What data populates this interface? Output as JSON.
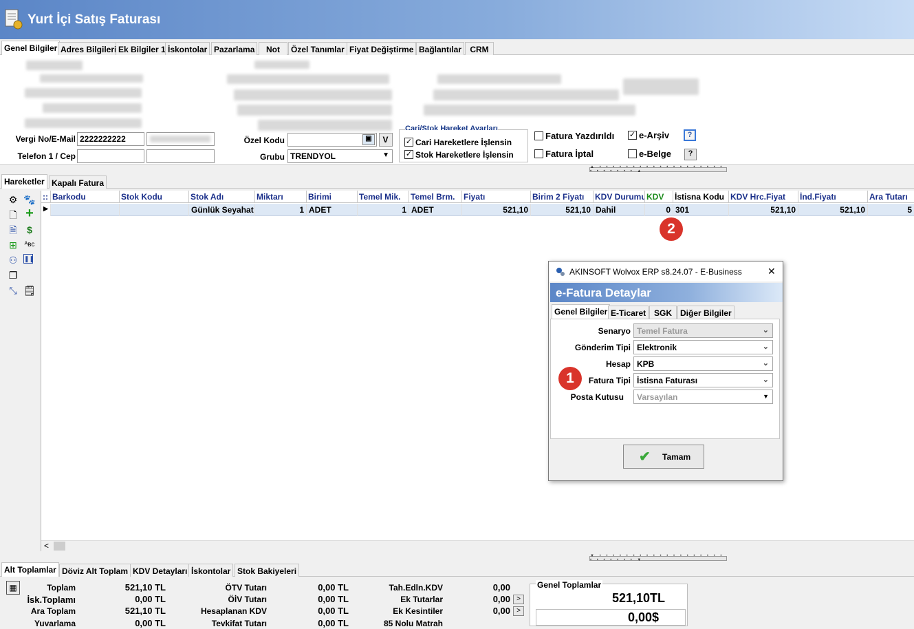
{
  "window": {
    "title": "Yurt İçi Satış Faturası"
  },
  "top_tabs": [
    "Genel Bilgiler",
    "Adres Bilgileri",
    "Ek Bilgiler 1",
    "İskontolar",
    "Pazarlama",
    "Not",
    "Özel Tanımlar",
    "Fiyat Değiştirme",
    "Bağlantılar",
    "CRM"
  ],
  "form": {
    "vergi_label": "Vergi No/E-Mail",
    "vergi_value": "2222222222",
    "telefon_label": "Telefon 1 / Cep",
    "ozel_kodu_label": "Özel Kodu",
    "v_button": "V",
    "grubu_label": "Grubu",
    "grubu_value": "TRENDYOL",
    "cari_group_title": "Cari/Stok Hareket Ayarları",
    "cari_hareket": "Cari Hareketlere İşlensin",
    "stok_hareket": "Stok Hareketlere İşlensin",
    "fatura_yazdirildi": "Fatura Yazdırıldı",
    "fatura_iptal": "Fatura İptal",
    "e_arsiv": "e-Arşiv",
    "e_belge": "e-Belge",
    "help": "?"
  },
  "mid_tabs": [
    "Hareketler",
    "Kapalı Fatura"
  ],
  "grid": {
    "columns": [
      "Barkodu",
      "Stok Kodu",
      "Stok Adı",
      "Miktarı",
      "Birimi",
      "Temel Mik.",
      "Temel Brm.",
      "Fiyatı",
      "Birim 2 Fiyatı",
      "KDV Durumu",
      "KDV",
      "İstisna Kodu",
      "KDV Hrc.Fiyat",
      "İnd.Fiyatı",
      "Ara Tutarı"
    ],
    "rows": [
      [
        "",
        "",
        "Günlük Seyahat",
        "1",
        "ADET",
        "1",
        "ADET",
        "521,10",
        "521,10",
        "Dahil",
        "0",
        "301",
        "521,10",
        "521,10",
        "5"
      ]
    ],
    "scroll_left": "<"
  },
  "badges": {
    "one": "1",
    "two": "2"
  },
  "dialog": {
    "title": "AKINSOFT Wolvox ERP s8.24.07 - E-Business",
    "close": "✕",
    "header": "e-Fatura Detaylar",
    "tabs": [
      "Genel Bilgiler",
      "E-Ticaret",
      "SGK",
      "Diğer Bilgiler"
    ],
    "fields": [
      {
        "label": "Senaryo",
        "value": "Temel Fatura"
      },
      {
        "label": "Gönderim Tipi",
        "value": "Elektronik"
      },
      {
        "label": "Hesap",
        "value": "KPB"
      },
      {
        "label": "Fatura Tipi",
        "value": "İstisna Faturası"
      },
      {
        "label": "Posta Kutusu",
        "value": "Varsayılan"
      }
    ],
    "ok_button": "Tamam"
  },
  "bottom_tabs": [
    "Alt Toplamlar",
    "Döviz Alt Toplam",
    "KDV Detayları",
    "İskontolar",
    "Stok Bakiyeleri"
  ],
  "totals": {
    "col1": [
      {
        "label": "Toplam",
        "value": "521,10 TL"
      },
      {
        "label": "İsk.Toplamı",
        "value": "0,00 TL"
      },
      {
        "label": "Ara Toplam",
        "value": "521,10 TL"
      },
      {
        "label": "Yuvarlama",
        "value": "0,00 TL"
      }
    ],
    "col2": [
      {
        "label": "ÖTV Tutarı",
        "value": "0,00 TL"
      },
      {
        "label": "ÖİV Tutarı",
        "value": "0,00 TL"
      },
      {
        "label": "Hesaplanan KDV",
        "value": "0,00 TL"
      },
      {
        "label": "Tevkifat Tutarı",
        "value": "0,00 TL"
      }
    ],
    "col3": [
      {
        "label": "Tah.Edln.KDV",
        "value": "0,00"
      },
      {
        "label": "Ek Tutarlar",
        "value": "0,00"
      },
      {
        "label": "Ek Kesintiler",
        "value": "0,00"
      },
      {
        "label": "85 Nolu Matrah",
        "value": ""
      }
    ],
    "arrow": ">",
    "genel_title": "Genel Toplamlar",
    "genel_tl": "521,10TL",
    "genel_usd": "0,00$"
  }
}
